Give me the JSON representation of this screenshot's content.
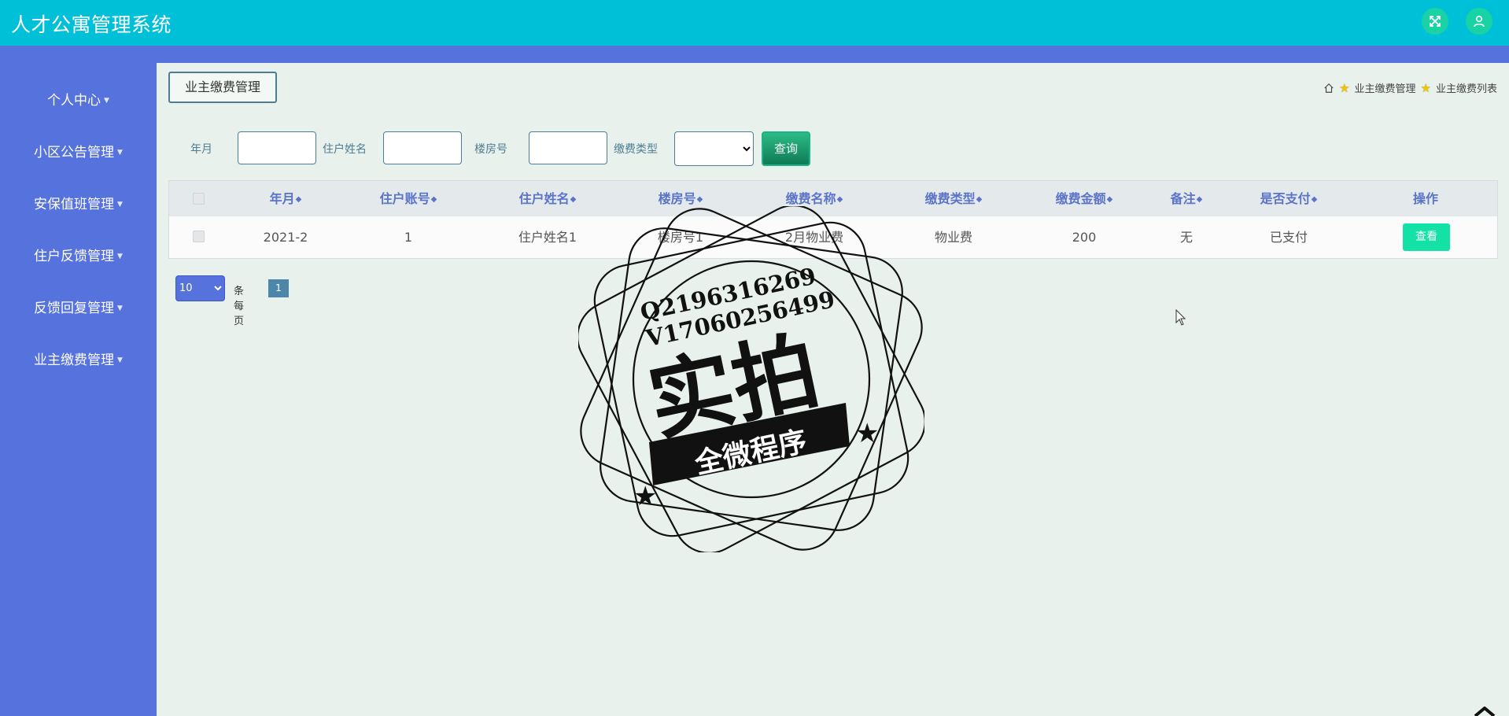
{
  "app": {
    "title": "人才公寓管理系统"
  },
  "sidebar": {
    "items": [
      {
        "label": "个人中心"
      },
      {
        "label": "小区公告管理"
      },
      {
        "label": "安保值班管理"
      },
      {
        "label": "住户反馈管理"
      },
      {
        "label": "反馈回复管理"
      },
      {
        "label": "业主缴费管理"
      }
    ]
  },
  "page": {
    "tab_label": "业主缴费管理",
    "breadcrumb": [
      "业主缴费管理",
      "业主缴费列表"
    ]
  },
  "search": {
    "fields": [
      {
        "label": "年月",
        "value": ""
      },
      {
        "label": "住户姓名",
        "value": ""
      },
      {
        "label": "楼房号",
        "value": ""
      }
    ],
    "fee_type": {
      "label": "缴费类型",
      "selected": ""
    },
    "query_label": "查询"
  },
  "table": {
    "columns": [
      "年月",
      "住户账号",
      "住户姓名",
      "楼房号",
      "缴费名称",
      "缴费类型",
      "缴费金额",
      "备注",
      "是否支付",
      "操作"
    ],
    "rows": [
      {
        "cells": [
          "2021-2",
          "1",
          "住户姓名1",
          "楼房号1",
          "2月物业费",
          "物业费",
          "200",
          "无",
          "已支付"
        ],
        "action": "查看"
      }
    ]
  },
  "pagination": {
    "page_size": "10",
    "per_page_label": "条每页",
    "current_page": "1"
  },
  "watermark": {
    "line1": "Q2196316269",
    "line2": "V17060256499",
    "main": "实拍",
    "banner": "全微程序"
  },
  "colors": {
    "topbar": "#00c0d8",
    "sidebar": "#5672dd",
    "accent_green": "#14e1a5",
    "header_text": "#5b74c8"
  }
}
